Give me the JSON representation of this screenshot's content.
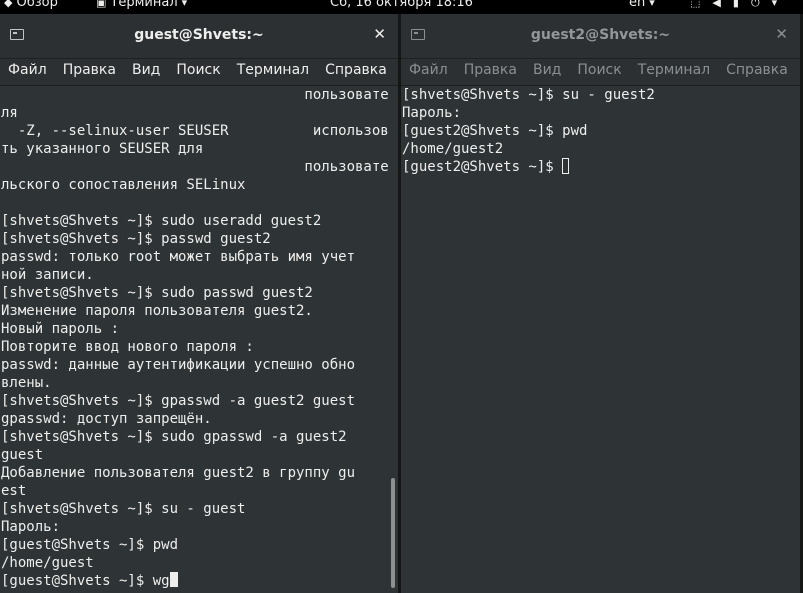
{
  "topbar": {
    "activities": "Обзор",
    "app_menu": "Терминал",
    "clock": "Сб, 16 октября  18:16",
    "lang": "en"
  },
  "windows": [
    {
      "title": "guest@Shvets:~",
      "menu": [
        "Файл",
        "Правка",
        "Вид",
        "Поиск",
        "Терминал",
        "Справка"
      ],
      "lines": [
        "                                    пользовате",
        "ля",
        "  -Z, --selinux-user SEUSER          использова",
        "ть указанного SEUSER для",
        "                                    пользовате",
        "льского сопоставления SELinux",
        "",
        "[shvets@Shvets ~]$ sudo useradd guest2",
        "[shvets@Shvets ~]$ passwd guest2",
        "passwd: только root может выбрать имя учет",
        "ной записи.",
        "[shvets@Shvets ~]$ sudo passwd guest2",
        "Изменение пароля пользователя guest2.",
        "Новый пароль :",
        "Повторите ввод нового пароля :",
        "passwd: данные аутентификации успешно обно",
        "влены.",
        "[shvets@Shvets ~]$ gpasswd -a guest2 guest",
        "gpasswd: доступ запрещён.",
        "[shvets@Shvets ~]$ sudo gpasswd -a guest2",
        "guest",
        "Добавление пользователя guest2 в группу gu",
        "est",
        "[shvets@Shvets ~]$ su - guest",
        "Пароль:",
        "[guest@Shvets ~]$ pwd",
        "/home/guest"
      ],
      "prompt_line": "[guest@Shvets ~]$ wg"
    },
    {
      "title": "guest2@Shvets:~",
      "menu": [
        "Файл",
        "Правка",
        "Вид",
        "Поиск",
        "Терминал",
        "Справка"
      ],
      "lines": [
        "[shvets@Shvets ~]$ su - guest2",
        "Пароль:",
        "[guest2@Shvets ~]$ pwd",
        "/home/guest2"
      ],
      "prompt_line": "[guest2@Shvets ~]$ "
    }
  ],
  "icons": [
    "terminal-tab-icon",
    "close-icon",
    "network-icon",
    "volume-icon",
    "battery-icon",
    "power-menu-icon",
    "dropdown-arrow-icon"
  ],
  "colors": {
    "terminal_bg": "#2e3436",
    "terminal_fg": "#eeeeec",
    "topbar_bg": "#000000"
  }
}
